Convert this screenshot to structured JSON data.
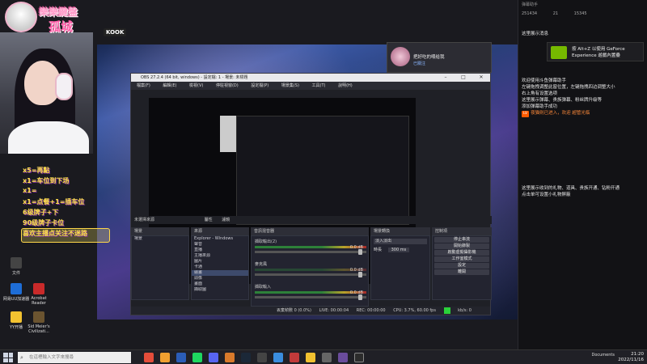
{
  "streamer": {
    "overlay_title": "樂樂鍵盤",
    "name": "孤城",
    "platform_badge": "KOOK"
  },
  "perks": [
    "x5=再點",
    "x1=车位到下场",
    "x1=",
    "x1=点餐+1=插车位",
    "6级牌子+下",
    "90级牌子卡位",
    "喜欢主播点关注不迷路"
  ],
  "desktop_icons": [
    {
      "name": "网易UU加速器",
      "label": "网易UU加速器",
      "color": "#1e6dd6"
    },
    {
      "name": "Acrobat Reader",
      "label": "Acrobat Reader",
      "color": "#c92a2a"
    },
    {
      "name": "文件",
      "label": "文件",
      "color": "#444"
    },
    {
      "name": "YY开播",
      "label": "YY开播",
      "color": "#f2c230"
    },
    {
      "name": "Sid Meier's Civilization",
      "label": "Sid Meier's Civilizati...",
      "color": "#6b5430"
    }
  ],
  "obs": {
    "title": "OBS 27.2.4 (64 bit, windows) - 設定檔: 1 - 場景: 未標題",
    "menu": [
      "檔案(F)",
      "編輯(E)",
      "檢視(V)",
      "停駐視窗(D)",
      "設定檔(P)",
      "場景集(S)",
      "工具(T)",
      "說明(H)"
    ],
    "preview_label": "未選擇來源",
    "props_button": "屬性",
    "filters_button": "濾鏡",
    "scenes_header": "場景",
    "scenes": [
      "場景"
    ],
    "sources_header": "來源",
    "sources": [
      "Explorer - Windows",
      "聲音",
      "直播",
      "主播來源",
      "圖片",
      "卡通",
      "繪畫",
      "頭像",
      "畫面",
      "擷取圖",
      "顯示器擷取"
    ],
    "mixer_header": "音訊混音器",
    "mixer_tracks": [
      {
        "name": "擷取輸出(2)",
        "db": "0.0 dB"
      },
      {
        "name": "麥克風",
        "db": "0.0 dB"
      },
      {
        "name": "擷取輸入",
        "db": "0.0 dB"
      }
    ],
    "transitions_header": "場景轉換",
    "transition_type": "淡入淡出",
    "duration_label": "時長",
    "duration_value": "300 ms",
    "controls_header": "控制項",
    "controls": [
      "停止串流",
      "開始錄製",
      "啟動虛擬攝影機",
      "工作室模式",
      "設定",
      "離開"
    ],
    "status": {
      "dropped": "丟棄幀數 0 (0.0%)",
      "live": "LIVE: 00:00:04",
      "rec": "REC: 00:00:00",
      "cpu": "CPU: 3.7%, 60.00 fps",
      "bitrate": "kb/s: 0"
    }
  },
  "notification": {
    "user": "把好吃的喂给我",
    "action": "已關注"
  },
  "chat": {
    "title": "弹幕助手",
    "viewers": "251434",
    "fans": "21",
    "likes": "15345",
    "gf_text": "按 Alt+Z 以使用 GeForce Experience 遊戲內置疊",
    "lines": [
      {
        "text": "这里展示消息",
        "style": "normal"
      },
      {
        "text": "欢迎使用斗鱼弹幕助手",
        "style": "normal"
      },
      {
        "text": "左键拖拽调整此窗位置，左键拖拽四边调整大小",
        "style": "normal"
      },
      {
        "text": "右上角有设置选项",
        "style": "normal"
      },
      {
        "text": "这里展示弹幕、贵族弹幕、粉丝牌升级等",
        "style": "normal"
      },
      {
        "text": "添加弹幕助手成功",
        "style": "normal"
      },
      {
        "text": "夜猫则已进入，欢迎 超管光临",
        "style": "orange"
      },
      {
        "text": "这里展示收到的礼物、道具、贵族开通、钻粉开通",
        "style": "normal"
      },
      {
        "text": "点击单可设置小礼物屏蔽",
        "style": "normal"
      }
    ]
  },
  "taskbar": {
    "search_placeholder": "在這裡輸入文字來搜尋",
    "documents_label": "Documents",
    "time": "21:20",
    "date": "2022/11/16"
  },
  "colors": {
    "accent_green": "#2ad13a",
    "overlay_pink": "#ff5fa8",
    "perk_yellow": "#ffe14a",
    "chat_orange": "#ff8a3a"
  }
}
